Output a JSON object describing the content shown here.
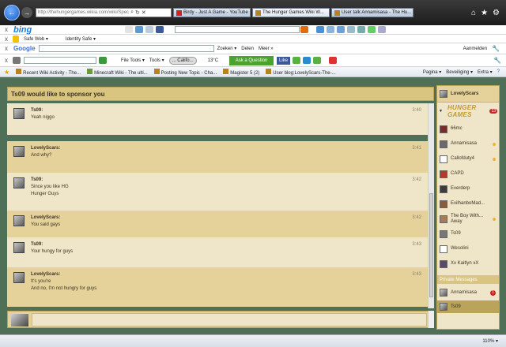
{
  "browser": {
    "address": "http://thehungergames.wikia.com/wiki/Spec",
    "address_host": "thehungergames",
    "tabs": [
      {
        "label": "Birdy - Just A Game - YouTube",
        "favicon_color": "#d32020",
        "active": false
      },
      {
        "label": "The Hunger Games Wiki W...",
        "favicon_color": "#b8821f",
        "active": true
      },
      {
        "label": "User talk:Annamisasa - The Hu...",
        "favicon_color": "#b8821f",
        "active": false
      }
    ]
  },
  "bing": {
    "logo": "bing",
    "safe_web": "Safe Web ▾",
    "identity_safe": "Identity Safe ▾"
  },
  "google": {
    "logo": "Google",
    "search_button": "Zoeken ▾",
    "share": "Delen",
    "more": "Meer »",
    "signin": "Aanmelden"
  },
  "ask": {
    "file_tools": "File Tools ▾",
    "tools": "Tools ▾",
    "caption": "... Califo...",
    "temperature": "13°C",
    "ask_button": "Ask a Question",
    "like": "Like"
  },
  "favorites": [
    "Recent Wiki Activity - The...",
    "Minecraft Wiki - The ulti...",
    "Posting New Topic - Cha...",
    "Magister 5 (2)",
    "User blog:LovelyScars-The-..."
  ],
  "command_bar": {
    "page": "Pagina ▾",
    "safety": "Beveiliging ▾",
    "extra": "Extra ▾",
    "help": "?"
  },
  "chat": {
    "title": "Ts09 would like to sponsor you",
    "messages": [
      {
        "user": "Ts09:",
        "lines": [
          "Yeah niggo"
        ],
        "time": "3:40"
      },
      {
        "user": "LovelyScars:",
        "lines": [
          "And why?"
        ],
        "time": "3:41"
      },
      {
        "user": "Ts09:",
        "lines": [
          "Since you like HG",
          "Hunger Guys"
        ],
        "time": "3:42"
      },
      {
        "user": "LovelyScars:",
        "lines": [
          "You said gays"
        ],
        "time": "3:42"
      },
      {
        "user": "Ts09:",
        "lines": [
          "Your hungy for guys"
        ],
        "time": "3:43"
      },
      {
        "user": "LovelyScars:",
        "lines": [
          "It's you're",
          "And no, I'm not hungry for guys"
        ],
        "time": "3:43"
      }
    ],
    "message_placeholder": ""
  },
  "sidebar": {
    "me": "LovelyScars",
    "wiki_logo": "HUNGER GAMES",
    "wiki_count": "13",
    "users": [
      {
        "name": "66mc",
        "away": false,
        "color": "#7a2c2c"
      },
      {
        "name": "Annamisasa",
        "away": true,
        "color": "#6a6a6a"
      },
      {
        "name": "Callofduty4",
        "away": true,
        "color": "#ffffff"
      },
      {
        "name": "CAPD",
        "away": false,
        "color": "#b53a2a"
      },
      {
        "name": "Everderp",
        "away": false,
        "color": "#3c3c3c"
      },
      {
        "name": "EvilhanboMad...",
        "away": false,
        "color": "#8b5a3a"
      },
      {
        "name": "The Boy With... Away",
        "away": true,
        "color": "#a87a5a"
      },
      {
        "name": "Ts09",
        "away": false,
        "color": "#777777"
      },
      {
        "name": "Wesolini",
        "away": false,
        "color": "#ffffff"
      },
      {
        "name": "Xx Kaitlyn xX",
        "away": false,
        "color": "#5a4a6a"
      }
    ],
    "pm_header": "Private Messages",
    "pm": [
      {
        "name": "Annamisasa",
        "badge": "1",
        "selected": false
      },
      {
        "name": "Ts09",
        "badge": "",
        "selected": true
      }
    ]
  },
  "status": {
    "zoom": "110% ▾"
  }
}
